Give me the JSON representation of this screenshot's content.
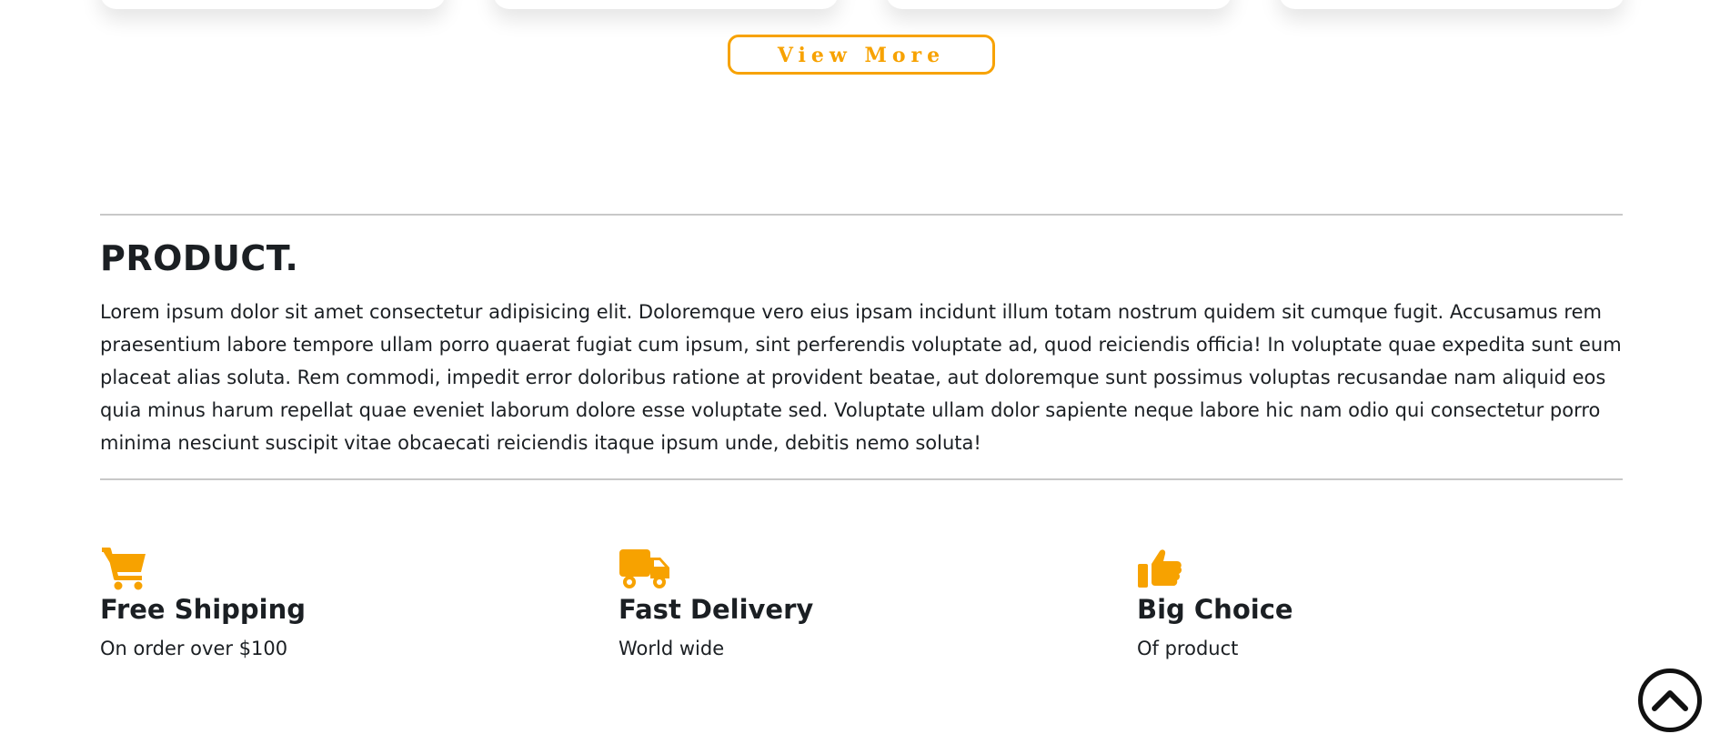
{
  "view_more": {
    "label": "View More"
  },
  "product": {
    "title": "PRODUCT.",
    "text": "Lorem ipsum dolor sit amet consectetur adipisicing elit. Doloremque vero eius ipsam incidunt illum totam nostrum quidem sit cumque fugit. Accusamus rem praesentium labore tempore ullam porro quaerat fugiat cum ipsum, sint perferendis voluptate ad, quod reiciendis officia! In voluptate quae expedita sunt eum placeat alias soluta. Rem commodi, impedit error doloribus ratione at provident beatae, aut doloremque sunt possimus voluptas recusandae nam aliquid eos quia minus harum repellat quae eveniet laborum dolore esse voluptate sed. Voluptate ullam dolor sapiente neque labore hic nam odio qui consectetur porro minima nesciunt suscipit vitae obcaecati reiciendis itaque ipsum unde, debitis nemo soluta!"
  },
  "features": [
    {
      "icon": "shopping-cart-icon",
      "title": "Free Shipping",
      "subtitle": "On order over $100"
    },
    {
      "icon": "truck-icon",
      "title": "Fast Delivery",
      "subtitle": "World wide"
    },
    {
      "icon": "thumbs-up-icon",
      "title": "Big Choice",
      "subtitle": "Of product"
    }
  ],
  "colors": {
    "accent": "#f7a200",
    "text": "#1b1f23",
    "divider": "#c8c8c8"
  },
  "scroll_top": {
    "icon": "chevron-up-icon"
  }
}
